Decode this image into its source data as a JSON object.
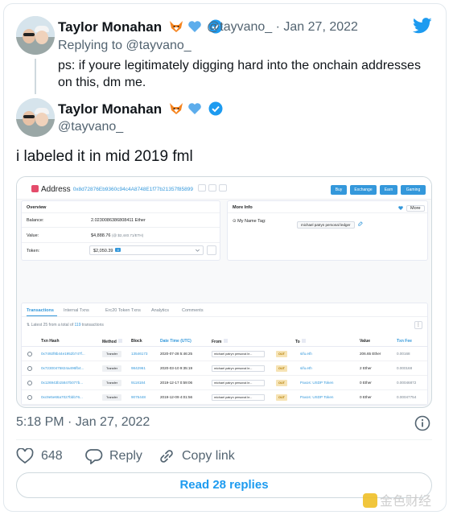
{
  "tweet1": {
    "display_name": "Taylor Monahan",
    "handle_date": "@tayvano_ · Jan 27, 2022",
    "replying_prefix": "Replying to ",
    "replying_handle": "@tayvano_",
    "text": "ps: if youre legitimately digging hard into the onchain addresses on this, dm me."
  },
  "tweet2": {
    "display_name": "Taylor Monahan",
    "handle": "@tayvano_",
    "text": "i labeled it in mid 2019 fml",
    "timestamp": "5:18 PM · Jan 27, 2022",
    "likes": "648",
    "reply_label": "Reply",
    "copy_link_label": "Copy link",
    "read_replies": "Read 28 replies"
  },
  "etherscan": {
    "title": "Address",
    "address": "0x8d72876Eb9360c94c4A8748E1f77b21357f85899",
    "buttons": [
      "Buy",
      "Exchange",
      "Earn",
      "Gaming"
    ],
    "overview": {
      "title": "Overview",
      "balance_label": "Balance:",
      "balance_value": "2.0230086386808411 Ether",
      "value_label": "Value:",
      "value_value": "$4,888.76",
      "value_note": "(@ $2,440.71/ETH)",
      "token_label": "Token:",
      "token_value": "$2,050.39",
      "token_badge": "4"
    },
    "more_info": {
      "title": "More Info",
      "more_label": "More",
      "name_tag_label": "My Name Tag:",
      "name_tag_value": "michael patryn personal ledger"
    },
    "tabs": [
      "Transactions",
      "Internal Txns",
      "Erc20 Token Txns",
      "Analytics",
      "Comments"
    ],
    "latest_prefix": "Latest 25 from a total of ",
    "latest_count": "119",
    "latest_suffix": " transactions",
    "columns": [
      "Txn Hash",
      "Method",
      "Block",
      "Date Time (UTC)",
      "From",
      "To",
      "Value",
      "Txn Fee"
    ],
    "rows": [
      {
        "hash": "0x7492f8b44e1952b747f...",
        "method": "Transfer",
        "block": "13546173",
        "date": "2020-07-28 5:46:25",
        "from": "michael patryn personal le...",
        "dir": "OUT",
        "to": "sifu.eth",
        "value": "206.65 Ether",
        "fee": "0.00168"
      },
      {
        "hash": "0x72300475824a496fb4...",
        "method": "Transfer",
        "block": "9842961",
        "date": "2020-03-10 9:35:19",
        "from": "michael patryn personal le...",
        "dir": "OUT",
        "to": "sifu.eth",
        "value": "2 Ether",
        "fee": "0.000168"
      },
      {
        "hash": "0x126943b15847b077b...",
        "method": "Transfer",
        "block": "9118184",
        "date": "2019-12-17 0:59:06",
        "from": "michael patryn personal le...",
        "dir": "OUT",
        "to": "Paxos: USDP Token",
        "value": "0 Ether",
        "fee": "0.00046872"
      },
      {
        "hash": "0xc9e5e66a7027bbb76...",
        "method": "Transfer",
        "block": "9075448",
        "date": "2019-12-09 4:01:56",
        "from": "michael patryn personal le...",
        "dir": "OUT",
        "to": "Paxos: USDP Token",
        "value": "0 Ether",
        "fee": "0.00047754"
      }
    ]
  },
  "watermark": "金色财经",
  "colors": {
    "twitter_blue": "#1d9bf0",
    "etherscan_blue": "#3498db",
    "out_badge": "#f6e3b4"
  },
  "icons": {
    "twitter": "twitter-bird-icon",
    "verified": "verified-badge-icon",
    "like": "heart-icon",
    "reply": "reply-bubble-icon",
    "copy_link": "link-icon",
    "info": "info-icon"
  }
}
